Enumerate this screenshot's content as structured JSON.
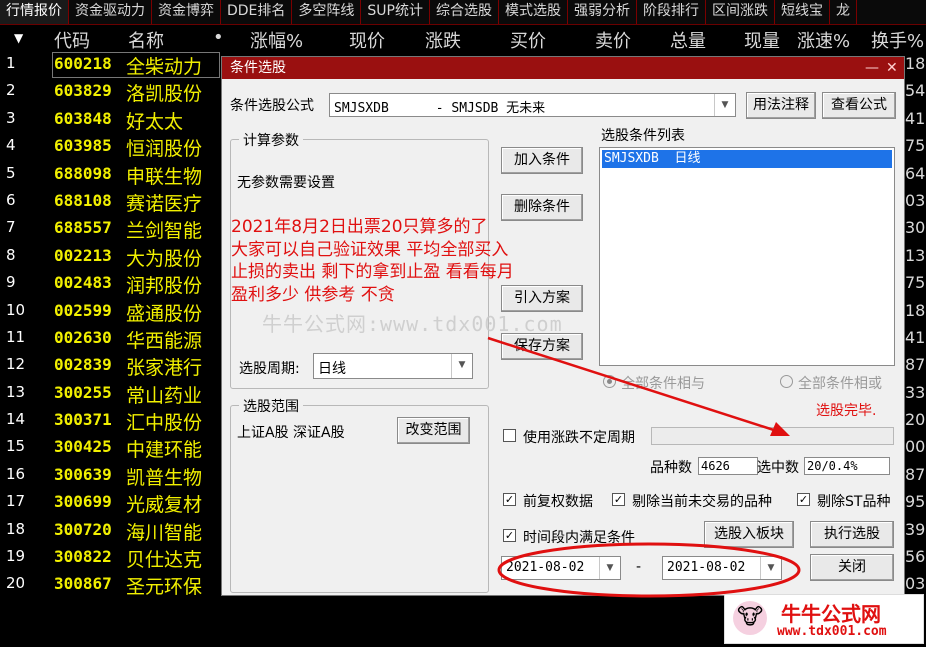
{
  "tabs": [
    "行情报价",
    "资金驱动力",
    "资金博弈",
    "DDE排名",
    "多空阵线",
    "SUP统计",
    "综合选股",
    "模式选股",
    "强弱分析",
    "阶段排行",
    "区间涨跌",
    "短线宝",
    "龙"
  ],
  "header": {
    "code": "代码",
    "name": "名称",
    "dot": "•",
    "zf": "涨幅%",
    "price": "现价",
    "zd": "涨跌",
    "buy": "买价",
    "sell": "卖价",
    "vol": "总量",
    "cur": "现量",
    "speed": "涨速%",
    "turn": "换手%"
  },
  "rows": [
    {
      "n": "1",
      "code": "600218",
      "name": "全柴动力",
      "r": "18"
    },
    {
      "n": "2",
      "code": "603829",
      "name": "洛凯股份",
      "r": "54"
    },
    {
      "n": "3",
      "code": "603848",
      "name": "好太太",
      "r": "41"
    },
    {
      "n": "4",
      "code": "603985",
      "name": "恒润股份",
      "r": "75"
    },
    {
      "n": "5",
      "code": "688098",
      "name": "申联生物",
      "r": "64"
    },
    {
      "n": "6",
      "code": "688108",
      "name": "赛诺医疗",
      "r": "03"
    },
    {
      "n": "7",
      "code": "688557",
      "name": "兰剑智能",
      "r": "30"
    },
    {
      "n": "8",
      "code": "002213",
      "name": "大为股份",
      "r": "13"
    },
    {
      "n": "9",
      "code": "002483",
      "name": "润邦股份",
      "r": "75"
    },
    {
      "n": "10",
      "code": "002599",
      "name": "盛通股份",
      "r": "18"
    },
    {
      "n": "11",
      "code": "002630",
      "name": "华西能源",
      "r": "41"
    },
    {
      "n": "12",
      "code": "002839",
      "name": "张家港行",
      "r": "87"
    },
    {
      "n": "13",
      "code": "300255",
      "name": "常山药业",
      "r": "33"
    },
    {
      "n": "14",
      "code": "300371",
      "name": "汇中股份",
      "r": "20"
    },
    {
      "n": "15",
      "code": "300425",
      "name": "中建环能",
      "r": "00"
    },
    {
      "n": "16",
      "code": "300639",
      "name": "凯普生物",
      "r": "87"
    },
    {
      "n": "17",
      "code": "300699",
      "name": "光威复材",
      "r": "95"
    },
    {
      "n": "18",
      "code": "300720",
      "name": "海川智能",
      "r": "39"
    },
    {
      "n": "19",
      "code": "300822",
      "name": "贝仕达克",
      "r": "56"
    },
    {
      "n": "20",
      "code": "300867",
      "name": "圣元环保",
      "r": "03"
    }
  ],
  "dialog": {
    "title": "条件选股",
    "min": "—",
    "close": "✕",
    "formula_label": "条件选股公式",
    "formula_value": "SMJSXDB      - SMJSDB 无未来",
    "usage_btn": "用法注释",
    "view_btn": "查看公式",
    "params_title": "计算参数",
    "params_text": "无参数需要设置",
    "add_btn": "加入条件",
    "del_btn": "删除条件",
    "import_btn": "引入方案",
    "save_btn": "保存方案",
    "cond_list_label": "选股条件列表",
    "cond_item": "SMJSXDB  日线",
    "period_label": "选股周期:",
    "period_value": "日线",
    "all_and": "全部条件相与",
    "all_or": "全部条件相或",
    "done_text": "选股完毕.",
    "range_title": "选股范围",
    "range_text": "上证A股 深证A股",
    "change_range_btn": "改变范围",
    "use_zd_period": "使用涨跌不定周期",
    "count_label": "品种数",
    "count_value": "4626",
    "selected_label": "选中数",
    "selected_value": "20/0.4%",
    "pre_restore": "前复权数据",
    "exclude_untraded": "剔除当前未交易的品种",
    "exclude_st": "剔除ST品种",
    "time_range": "时间段内满足条件",
    "to_block_btn": "选股入板块",
    "exec_btn": "执行选股",
    "date_from": "2021-08-02",
    "date_dash": "-",
    "date_to": "2021-08-02",
    "close_btn": "关闭"
  },
  "annotation": {
    "line1": "2021年8月2日出票20只算多的了",
    "line2": "大家可以自己验证效果 平均全部买入",
    "line3": "止损的卖出 剩下的拿到止盈 看看每月",
    "line4": "盈利多少 供参考 不贪"
  },
  "watermark": "牛牛公式网:www.tdx001.com",
  "logo": {
    "title": "牛牛公式网",
    "url": "www.tdx001.com"
  },
  "colors": {
    "accent_red": "#e01010",
    "title_bar": "#9a1010",
    "stock_yellow": "#f2f000",
    "select_blue": "#1e73e8"
  }
}
